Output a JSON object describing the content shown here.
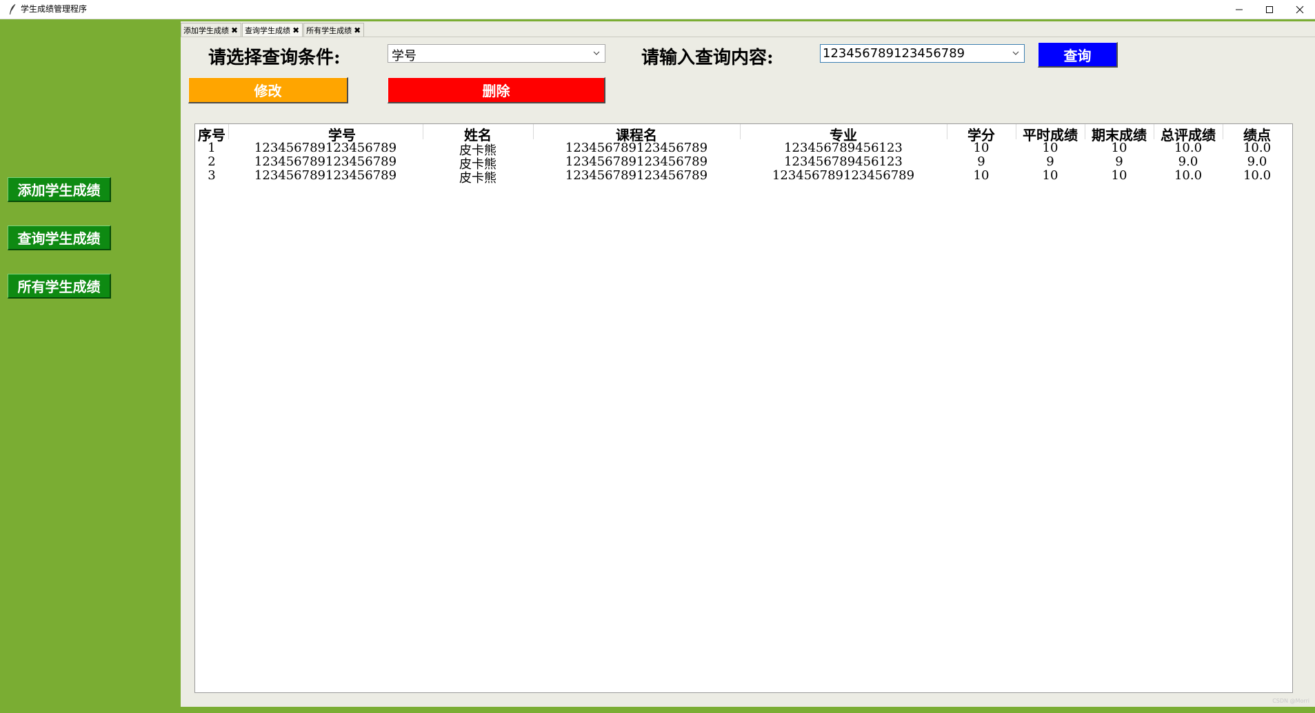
{
  "window": {
    "title": "学生成绩管理程序",
    "accent": "#7aad33"
  },
  "sidebar": {
    "items": [
      {
        "label": "添加学生成绩"
      },
      {
        "label": "查询学生成绩"
      },
      {
        "label": "所有学生成绩"
      }
    ]
  },
  "tabs": [
    {
      "label": "添加学生成绩",
      "close": "✖"
    },
    {
      "label": "查询学生成绩",
      "close": "✖"
    },
    {
      "label": "所有学生成绩",
      "close": "✖"
    }
  ],
  "query": {
    "condition_label": "请选择查询条件:",
    "condition_value": "学号",
    "content_label": "请输入查询内容:",
    "content_value": "123456789123456789",
    "search_button": "查询",
    "edit_button": "修改",
    "delete_button": "删除"
  },
  "colors": {
    "search_button": "#0000ff",
    "edit_button": "#ffa500",
    "delete_button": "#ff0000",
    "sidebar_button": "#0e8a12"
  },
  "table": {
    "columns": [
      "序号",
      "学号",
      "姓名",
      "课程名",
      "专业",
      "学分",
      "平时成绩",
      "期末成绩",
      "总评成绩",
      "绩点"
    ],
    "rows": [
      [
        "1",
        "123456789123456789",
        "皮卡熊",
        "123456789123456789",
        "123456789456123",
        "10",
        "10",
        "10",
        "10.0",
        "10.0"
      ],
      [
        "2",
        "123456789123456789",
        "皮卡熊",
        "123456789123456789",
        "123456789456123",
        "9",
        "9",
        "9",
        "9.0",
        "9.0"
      ],
      [
        "3",
        "123456789123456789",
        "皮卡熊",
        "123456789123456789",
        "123456789123456789",
        "10",
        "10",
        "10",
        "10.0",
        "10.0"
      ]
    ]
  },
  "footer": {
    "watermark": "CSDN @Morri"
  }
}
